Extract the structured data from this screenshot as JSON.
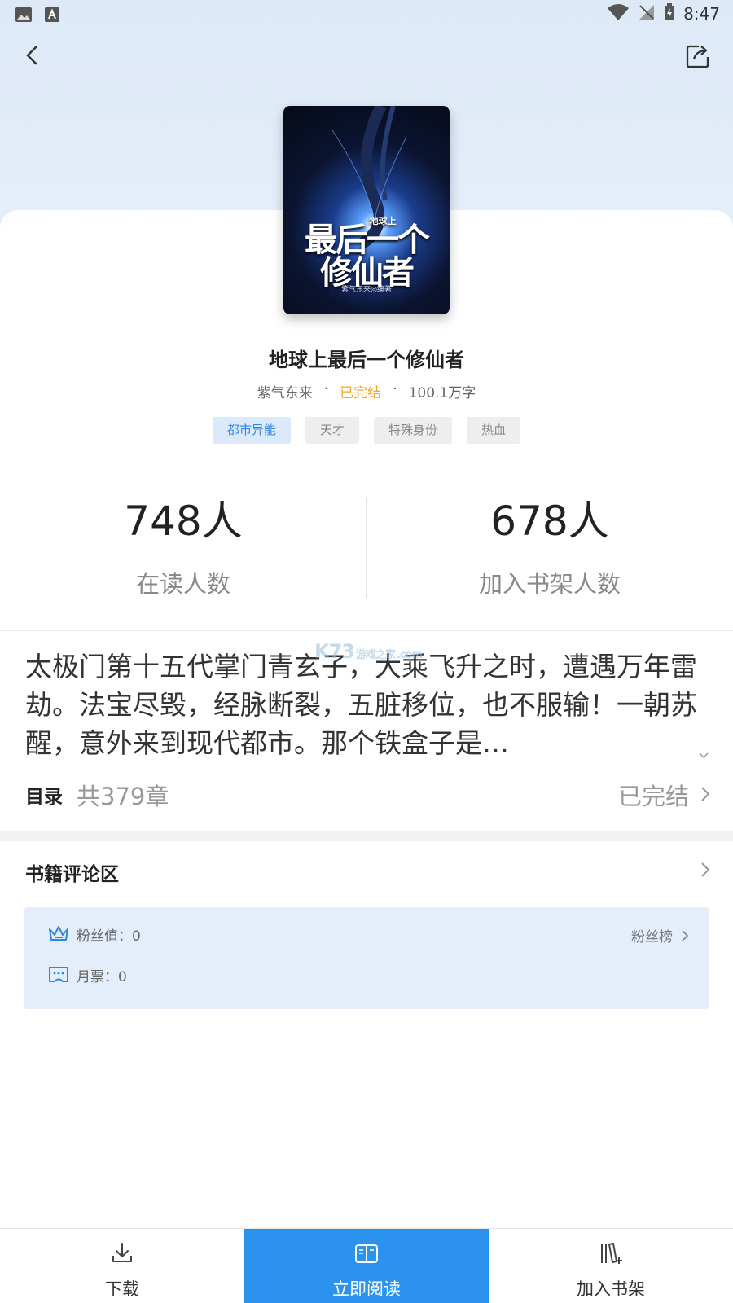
{
  "status_bar": {
    "time": "8:47",
    "icons": [
      "image-icon",
      "font-icon",
      "wifi-icon",
      "no-signal-icon",
      "battery-icon"
    ]
  },
  "header": {
    "back_icon": "chevron-left-icon",
    "share_icon": "share-icon"
  },
  "book": {
    "cover_title": "最后一个修仙者",
    "cover_subtitle": "地球上",
    "cover_author": "紫气东来◎编著",
    "title": "地球上最后一个修仙者",
    "author": "紫气东来",
    "status": "已完结",
    "word_count": "100.1万字",
    "tags": [
      "都市异能",
      "天才",
      "特殊身份",
      "热血"
    ]
  },
  "stats": {
    "reading": {
      "value": "748人",
      "label": "在读人数"
    },
    "bookshelf": {
      "value": "678人",
      "label": "加入书架人数"
    }
  },
  "synopsis": "太极门第十五代掌门青玄子，大乘飞升之时，遭遇万年雷劫。法宝尽毁，经脉断裂，五脏移位，也不服输！一朝苏醒，意外来到现代都市。那个铁盒子是…",
  "watermark": {
    "brand": "K73",
    "tagline": "游戏之家",
    "domain": ".com"
  },
  "toc": {
    "label": "目录",
    "count": "共379章",
    "status": "已完结"
  },
  "reviews": {
    "title": "书籍评论区",
    "fan_value": "粉丝值：0",
    "monthly_ticket": "月票：0",
    "fan_rank": "粉丝榜"
  },
  "bottom_bar": {
    "download": "下载",
    "read_now": "立即阅读",
    "add_shelf": "加入书架"
  },
  "colors": {
    "accent": "#2b93ee",
    "status_orange": "#f5a623",
    "tag_primary_bg": "#dbeafb",
    "fans_card_bg": "#e4eefa"
  }
}
